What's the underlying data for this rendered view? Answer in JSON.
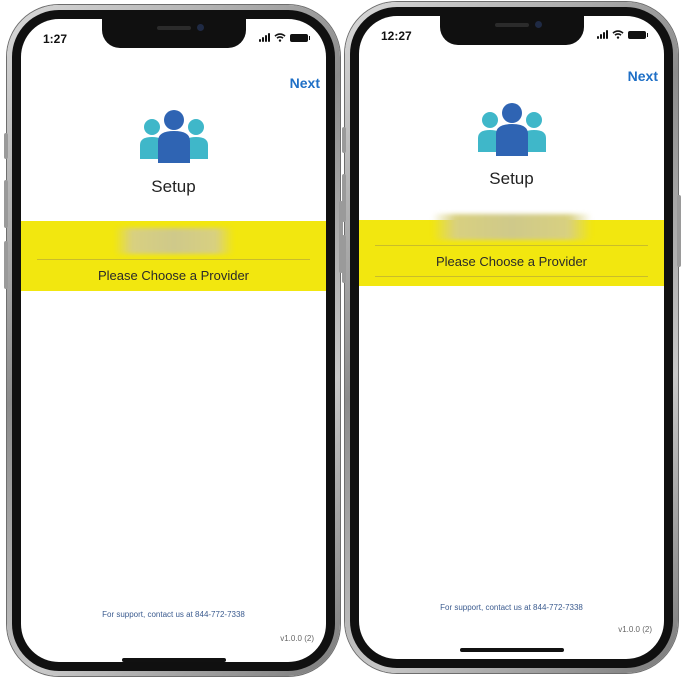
{
  "phones": [
    {
      "status_time": "1:27",
      "next_label": "Next",
      "setup_title": "Setup",
      "provider_prompt": "Please Choose a Provider",
      "support_text": "For support, contact us at 844-772-7338",
      "version": "v1.0.0 (2)"
    },
    {
      "status_time": "12:27",
      "next_label": "Next",
      "setup_title": "Setup",
      "provider_prompt": "Please Choose a Provider",
      "support_text": "For support, contact us at 844-772-7338",
      "version": "v1.0.0 (2)"
    }
  ],
  "icons": {
    "logo": "people-group-icon",
    "signal": "cellular-signal-icon",
    "wifi": "wifi-icon",
    "battery": "battery-icon"
  },
  "colors": {
    "accent": "#1e6fc6",
    "highlight": "#f2e70f",
    "logo_front": "#2f64b3",
    "logo_back": "#3fb7c9"
  }
}
